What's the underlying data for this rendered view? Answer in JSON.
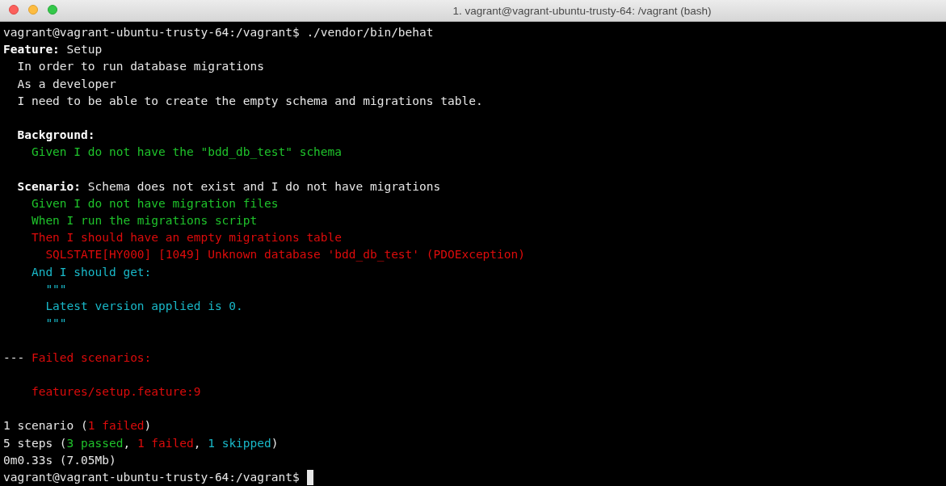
{
  "window": {
    "title": "1. vagrant@vagrant-ubuntu-trusty-64: /vagrant (bash)"
  },
  "blocks": [
    [
      {
        "segments": [
          {
            "text": "vagrant@vagrant-ubuntu-trusty-64:/vagrant$ ./vendor/bin/behat",
            "kind": "plain"
          }
        ]
      },
      {
        "segments": [
          {
            "text": "Feature:",
            "kind": "keyword"
          },
          {
            "text": " Setup",
            "kind": "plain"
          }
        ]
      },
      {
        "segments": [
          {
            "text": "  In order to run database migrations",
            "kind": "plain"
          }
        ]
      },
      {
        "segments": [
          {
            "text": "  As a developer",
            "kind": "plain"
          }
        ]
      },
      {
        "segments": [
          {
            "text": "  I need to be able to create the empty schema and migrations table.",
            "kind": "plain"
          }
        ]
      }
    ],
    [
      {
        "segments": [
          {
            "text": "  Background:",
            "kind": "keyword"
          }
        ]
      },
      {
        "segments": [
          {
            "text": "    Given I do not have the \"bdd_db_test\" schema",
            "kind": "passed"
          }
        ]
      }
    ],
    [
      {
        "segments": [
          {
            "text": "  Scenario:",
            "kind": "keyword"
          },
          {
            "text": " Schema does not exist and I do not have migrations",
            "kind": "plain"
          }
        ]
      },
      {
        "segments": [
          {
            "text": "    Given I do not have migration files",
            "kind": "passed"
          }
        ]
      },
      {
        "segments": [
          {
            "text": "    When I run the migrations script",
            "kind": "passed"
          }
        ]
      },
      {
        "segments": [
          {
            "text": "    Then I should have an empty migrations table",
            "kind": "failed"
          }
        ]
      },
      {
        "segments": [
          {
            "text": "      SQLSTATE[HY000] [1049] Unknown database 'bdd_db_test' (PDOException)",
            "kind": "failed"
          }
        ]
      },
      {
        "segments": [
          {
            "text": "    And I should get:",
            "kind": "skipped"
          }
        ]
      },
      {
        "segments": [
          {
            "text": "      \"\"\"",
            "kind": "skipped"
          }
        ]
      },
      {
        "segments": [
          {
            "text": "      Latest version applied is 0.",
            "kind": "skipped"
          }
        ]
      },
      {
        "segments": [
          {
            "text": "      \"\"\"",
            "kind": "skipped"
          }
        ]
      }
    ],
    [
      {
        "segments": [
          {
            "text": "--- ",
            "kind": "plain"
          },
          {
            "text": "Failed scenarios:",
            "kind": "failed"
          }
        ]
      }
    ],
    [
      {
        "segments": [
          {
            "text": "    features/setup.feature:9",
            "kind": "failed"
          }
        ]
      }
    ],
    [
      {
        "segments": [
          {
            "text": "1 scenario (",
            "kind": "plain"
          },
          {
            "text": "1 failed",
            "kind": "failed"
          },
          {
            "text": ")",
            "kind": "plain"
          }
        ]
      },
      {
        "segments": [
          {
            "text": "5 steps (",
            "kind": "plain"
          },
          {
            "text": "3 passed",
            "kind": "passed"
          },
          {
            "text": ", ",
            "kind": "plain"
          },
          {
            "text": "1 failed",
            "kind": "failed"
          },
          {
            "text": ", ",
            "kind": "plain"
          },
          {
            "text": "1 skipped",
            "kind": "skipped"
          },
          {
            "text": ")",
            "kind": "plain"
          }
        ]
      },
      {
        "segments": [
          {
            "text": "0m0.33s (7.05Mb)",
            "kind": "plain"
          }
        ]
      },
      {
        "segments": [
          {
            "text": "vagrant@vagrant-ubuntu-trusty-64:/vagrant$ ",
            "kind": "plain"
          }
        ],
        "cursor": true
      }
    ]
  ]
}
